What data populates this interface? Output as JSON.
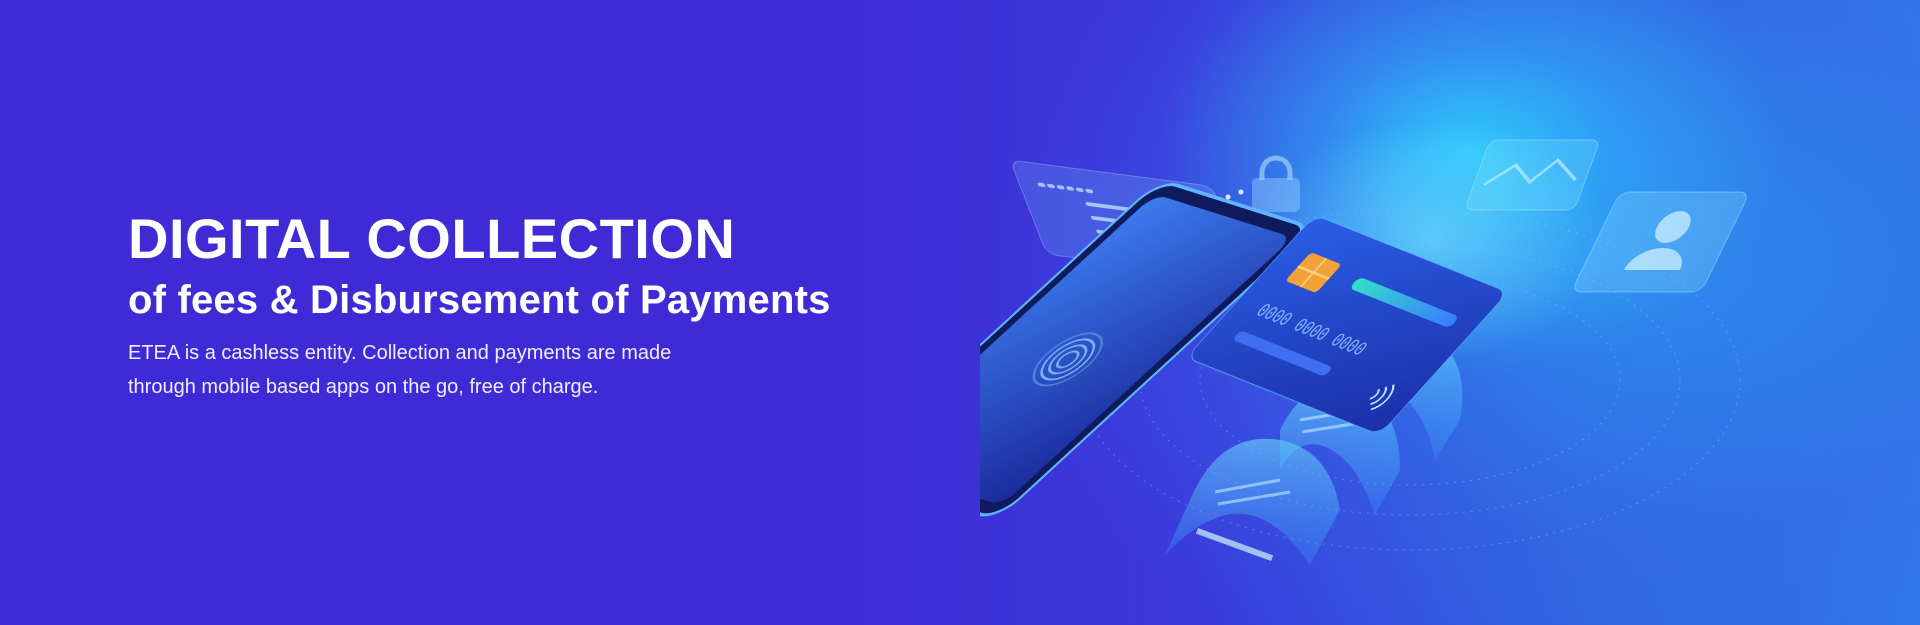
{
  "hero": {
    "title": "DIGITAL COLLECTION",
    "subtitle": "of fees & Disbursement of Payments",
    "description_line1": "ETEA is a cashless entity. Collection and payments are made",
    "description_line2": "through mobile based apps on the go, free of charge."
  },
  "illustration": {
    "card_number_text": "0000 0000 0000",
    "icons": [
      "document-icon",
      "lock-icon",
      "image-icon",
      "user-icon",
      "fingerprint-icon",
      "contactless-icon",
      "card-chip-icon"
    ]
  },
  "colors": {
    "background": "#3f2ad6",
    "glow": "#2ed6ff",
    "text": "#ffffff"
  }
}
